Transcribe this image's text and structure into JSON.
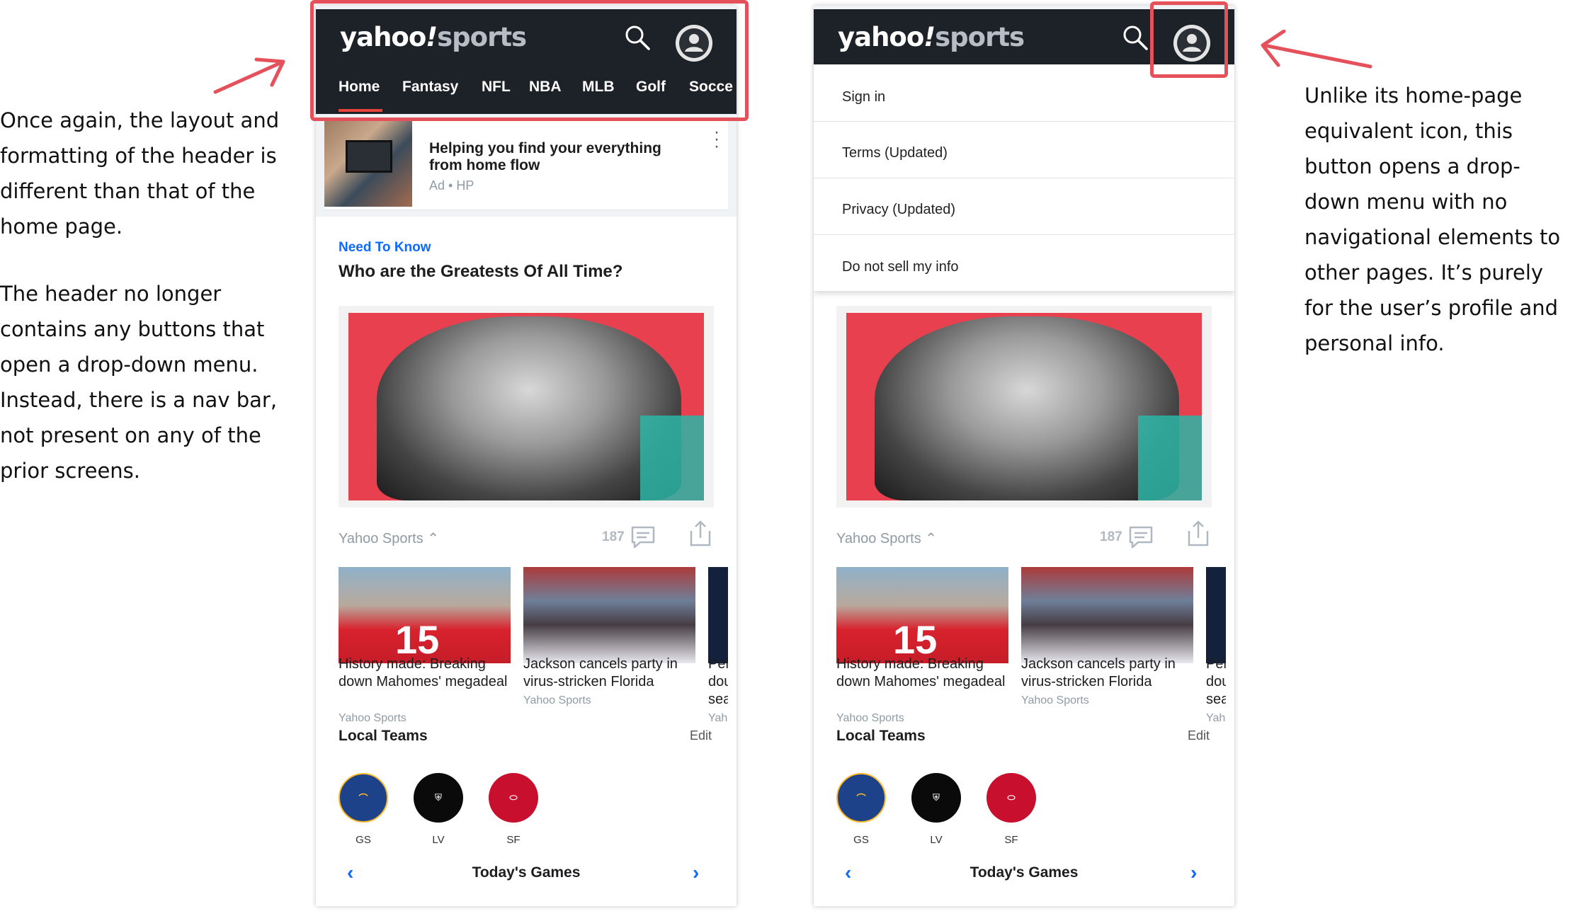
{
  "annotations": {
    "left_paragraph_1": "Once again, the layout and formatting of the header is different than that of the home page.",
    "left_paragraph_2": "The header no longer contains any buttons that open a drop-down menu. Instead, there is a nav bar, not present on any of the prior screens.",
    "right_paragraph": "Unlike its home-page equivalent icon, this button opens a drop-down menu with no navigational elements to other pages. It’s purely for the user’s profile and personal info.",
    "accent_color": "#e5515a"
  },
  "app": {
    "logo_yahoo": "yahoo",
    "logo_slash": "!",
    "logo_sports": "sports",
    "nav_tabs": [
      "Home",
      "Fantasy",
      "NFL",
      "NBA",
      "MLB",
      "Golf",
      "Socce"
    ],
    "active_tab": "Home",
    "header_bg": "#1d2228",
    "link_color": "#0f69ff"
  },
  "ad": {
    "title": "Helping you find your everything from home flow",
    "meta": "Ad • HP"
  },
  "featured": {
    "kicker": "Need To Know",
    "headline": "Who are the Greatests Of All Time?",
    "source": "Yahoo Sports",
    "comment_count": "187"
  },
  "stories": [
    {
      "title": "History made: Breaking down Mahomes' megadeal",
      "source": "Yahoo Sports",
      "jersey": "15"
    },
    {
      "title": "Jackson cancels party in virus-stricken Florida",
      "source": "Yahoo Sports"
    },
    {
      "title": "Pel dou sea",
      "source": "Yah"
    }
  ],
  "local_teams": {
    "title": "Local Teams",
    "edit_label": "Edit",
    "teams": [
      {
        "code": "GS"
      },
      {
        "code": "LV"
      },
      {
        "code": "SF"
      }
    ]
  },
  "games": {
    "title": "Today's Games",
    "prev": "‹",
    "next": "›"
  },
  "dropdown": {
    "items": [
      "Sign in",
      "Terms (Updated)",
      "Privacy (Updated)",
      "Do not sell my info"
    ]
  }
}
